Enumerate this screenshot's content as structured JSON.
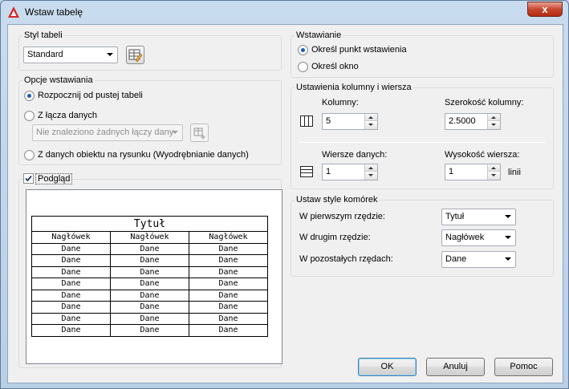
{
  "window": {
    "title": "Wstaw tabelę",
    "close_glyph": "x"
  },
  "table_style": {
    "group_label": "Styl tabeli",
    "selected": "Standard"
  },
  "insert_options": {
    "group_label": "Opcje wstawiania",
    "option_empty": "Rozpocznij od pustej tabeli",
    "option_link": "Z łącza danych",
    "link_combo": "Nie znaleziono żadnych łączy dany",
    "option_object": "Z danych obiektu na rysunku (Wyodrębnianie danych)"
  },
  "preview": {
    "label": "Podgląd",
    "checked": true,
    "title_cell": "Tytuł",
    "headers": [
      "Nagłówek",
      "Nagłówek",
      "Nagłówek"
    ],
    "rows": [
      [
        "Dane",
        "Dane",
        "Dane"
      ],
      [
        "Dane",
        "Dane",
        "Dane"
      ],
      [
        "Dane",
        "Dane",
        "Dane"
      ],
      [
        "Dane",
        "Dane",
        "Dane"
      ],
      [
        "Dane",
        "Dane",
        "Dane"
      ],
      [
        "Dane",
        "Dane",
        "Dane"
      ],
      [
        "Dane",
        "Dane",
        "Dane"
      ],
      [
        "Dane",
        "Dane",
        "Dane"
      ]
    ]
  },
  "insertion": {
    "group_label": "Wstawianie",
    "option_point": "Określ punkt wstawienia",
    "option_window": "Określ okno"
  },
  "column_row": {
    "group_label": "Ustawienia kolumny i wiersza",
    "columns_label": "Kolumny:",
    "columns_value": "5",
    "col_width_label": "Szerokość kolumny:",
    "col_width_value": "2.5000",
    "data_rows_label": "Wiersze danych:",
    "data_rows_value": "1",
    "row_height_label": "Wysokość wiersza:",
    "row_height_value": "1",
    "row_height_unit": "linii"
  },
  "cell_styles": {
    "group_label": "Ustaw style komórek",
    "first_row_label": "W pierwszym rzędzie:",
    "first_row_value": "Tytuł",
    "second_row_label": "W drugim rzędzie:",
    "second_row_value": "Nagłówek",
    "other_rows_label": "W pozostałych rzędach:",
    "other_rows_value": "Dane"
  },
  "buttons": {
    "ok": "OK",
    "cancel": "Anuluj",
    "help": "Pomoc"
  },
  "colors": {
    "accent": "#1c5cb9",
    "close": "#c8462f",
    "default_border": "#3c7fb1"
  }
}
